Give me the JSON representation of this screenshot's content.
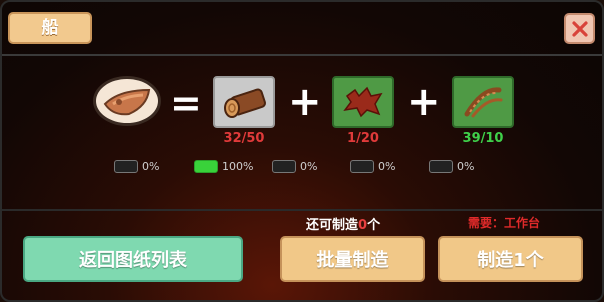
{
  "window": {
    "title": "船"
  },
  "recipe": {
    "operators": [
      "=",
      "+",
      "+"
    ],
    "ingredients": [
      {
        "icon": "log-icon",
        "count": "32/50",
        "count_color": "#e03a3a"
      },
      {
        "icon": "leather-hide-icon",
        "count": "1/20",
        "count_color": "#e03a3a"
      },
      {
        "icon": "rope-coil-icon",
        "count": "39/10",
        "count_color": "#3fd04a"
      }
    ]
  },
  "progress": [
    {
      "label": "0%",
      "level": 0
    },
    {
      "label": "100%",
      "level": 1
    },
    {
      "label": "0%",
      "level": 0
    },
    {
      "label": "0%",
      "level": 0
    },
    {
      "label": "0%",
      "level": 0
    }
  ],
  "status": {
    "prefix": "还可制造",
    "amount": "0",
    "suffix": "个",
    "requirement": "需要：工作台"
  },
  "buttons": {
    "back": "返回图纸列表",
    "batch": "批量制造",
    "one": "制造1个"
  },
  "colors": {
    "accent_tan": "#f1c888",
    "accent_mint": "#7fd9b0",
    "warn_red": "#e03a3a",
    "ok_green": "#3fd04a"
  }
}
